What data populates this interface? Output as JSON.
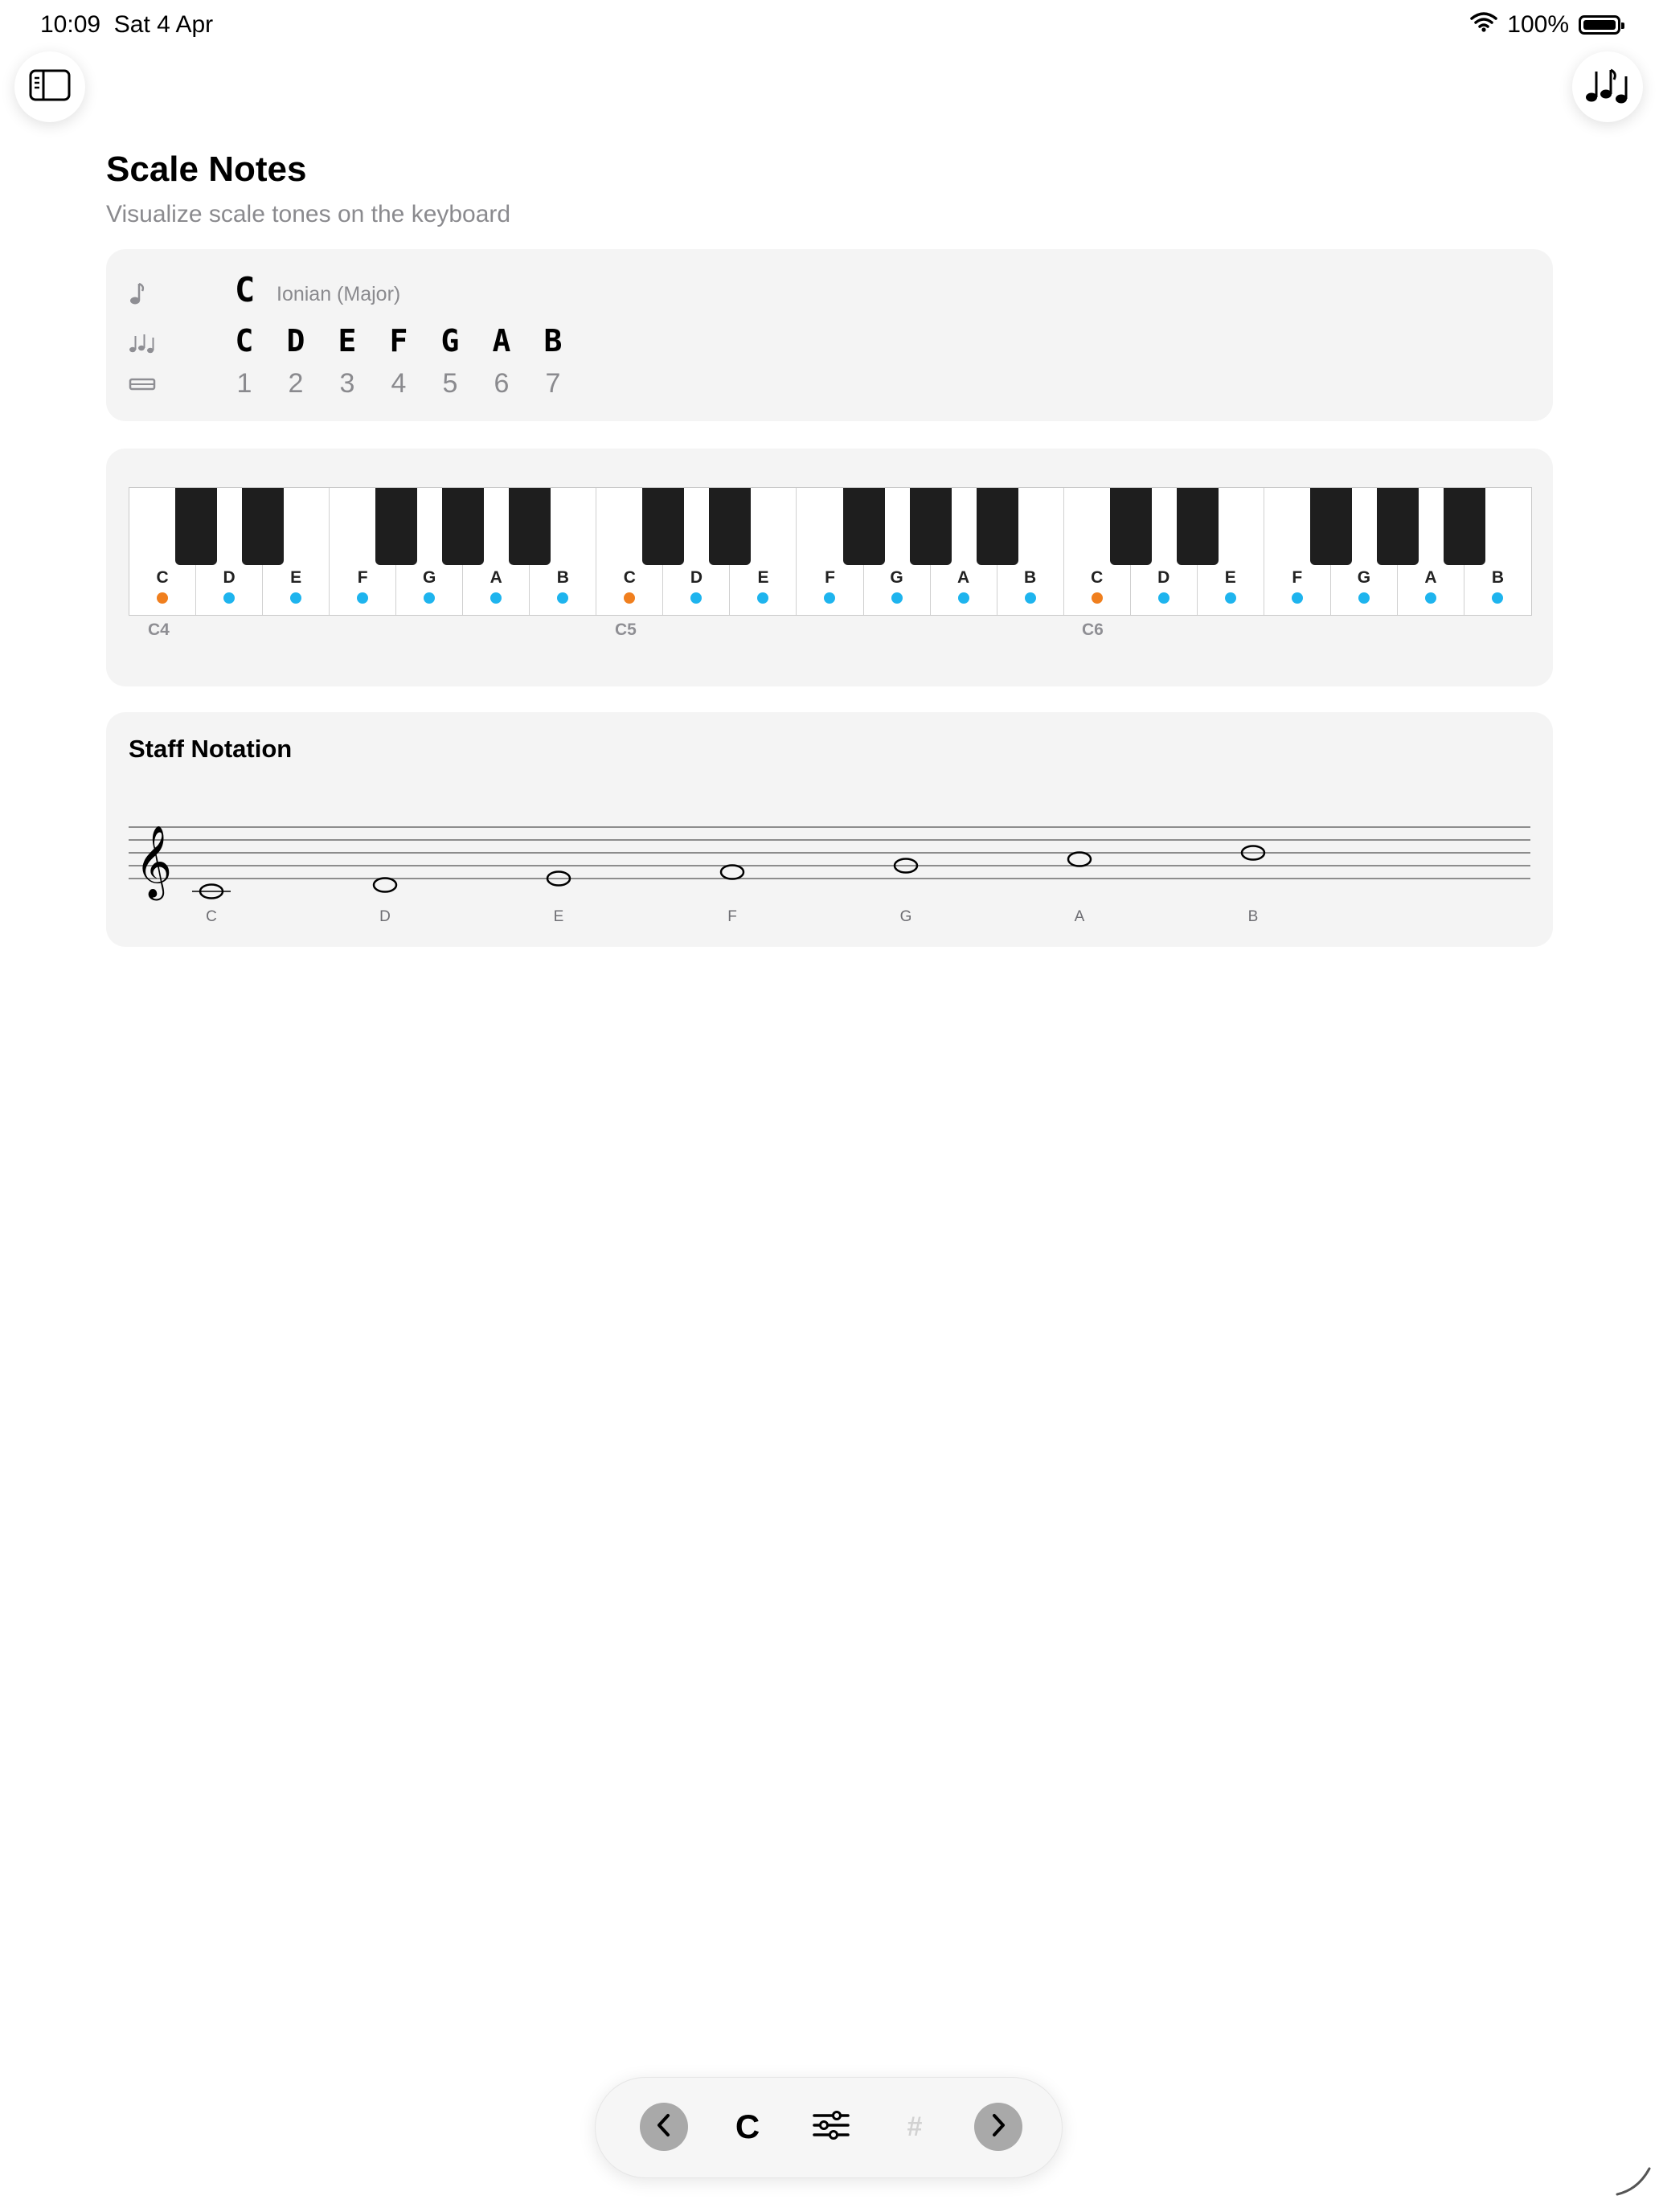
{
  "status_bar": {
    "time": "10:09",
    "date": "Sat 4 Apr",
    "battery": "100%",
    "icons": [
      "wifi-icon",
      "battery-icon"
    ]
  },
  "top_buttons": {
    "left_icon": "sidebar-toggle-icon",
    "right_icon": "music-notes-icon"
  },
  "header": {
    "title": "Scale Notes",
    "subtitle": "Visualize scale tones on the keyboard"
  },
  "scale_summary": {
    "root": "C",
    "mode": "Ionian (Major)",
    "notes": [
      "C",
      "D",
      "E",
      "F",
      "G",
      "A",
      "B"
    ],
    "degrees": [
      "1",
      "2",
      "3",
      "4",
      "5",
      "6",
      "7"
    ],
    "row_icons": [
      "single-note-icon",
      "notes-icon",
      "keyboard-icon"
    ]
  },
  "keyboard": {
    "white_keys": [
      {
        "label": "C",
        "root": true
      },
      {
        "label": "D"
      },
      {
        "label": "E"
      },
      {
        "label": "F"
      },
      {
        "label": "G"
      },
      {
        "label": "A"
      },
      {
        "label": "B"
      },
      {
        "label": "C",
        "root": true
      },
      {
        "label": "D"
      },
      {
        "label": "E"
      },
      {
        "label": "F"
      },
      {
        "label": "G"
      },
      {
        "label": "A"
      },
      {
        "label": "B"
      },
      {
        "label": "C",
        "root": true
      },
      {
        "label": "D"
      },
      {
        "label": "E"
      },
      {
        "label": "F"
      },
      {
        "label": "G"
      },
      {
        "label": "A"
      },
      {
        "label": "B"
      }
    ],
    "octave_labels": [
      "C4",
      "C5",
      "C6"
    ],
    "colors": {
      "root_dot": "#f07f1e",
      "scale_dot": "#1eb4ee",
      "black_key": "#1e1e1e"
    }
  },
  "staff": {
    "title": "Staff Notation",
    "clef": "treble",
    "notes": [
      "C",
      "D",
      "E",
      "F",
      "G",
      "A",
      "B"
    ]
  },
  "toolbar": {
    "key": "C",
    "sharp": "#",
    "icons": [
      "chevron-left-icon",
      "sliders-icon",
      "chevron-right-icon"
    ]
  }
}
